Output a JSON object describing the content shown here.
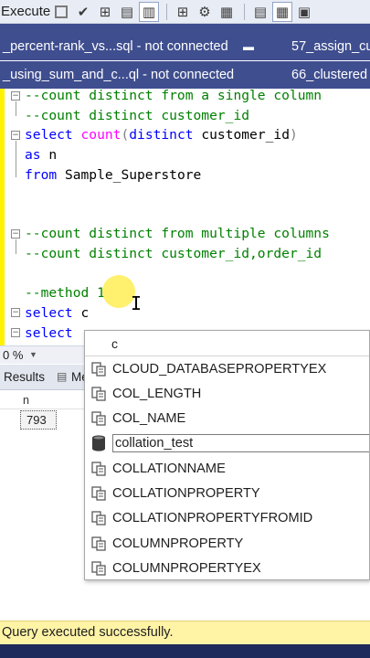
{
  "toolbar": {
    "execute_label": "Execute",
    "icons": [
      "stop-icon",
      "parse-checkmark-icon",
      "display-estimated-plan-icon",
      "query-options-icon",
      "results-to-text-icon",
      "display-plan-icon",
      "include-statistics-icon",
      "results-to-file-icon",
      "results-to-grid-icon",
      "results-to-text-alt-icon"
    ]
  },
  "tabs": {
    "row1": {
      "left": "_percent-rank_vs...sql - not connected",
      "pin": "▬",
      "right": "57_assign_cu"
    },
    "row2": {
      "left": "_using_sum_and_c...ql - not connected",
      "right": "66_clustered"
    }
  },
  "editor": {
    "lines": [
      "--count distinct from a single column",
      "--count distinct customer_id",
      "select count(distinct customer_id)",
      "as n",
      "from Sample_Superstore",
      "--count distinct from multiple columns",
      "--count distinct customer_id,order_id",
      "--method 1",
      "select c",
      "select"
    ],
    "tokens": {
      "select": "select",
      "count": "count",
      "lparen": "(",
      "distinct": "distinct",
      "customer_id": " customer_id",
      "rparen": ")",
      "as": "as",
      "n": " n",
      "from": "from",
      "table": " Sample_Superstore",
      "c": " c"
    }
  },
  "zoom": {
    "value": "0 %"
  },
  "results": {
    "results_tab": "Results",
    "messages_tab": "Me",
    "column_header": "n",
    "cell_value": "793"
  },
  "autocomplete": {
    "filter": "c",
    "items": [
      {
        "label": "CLOUD_DATABASEPROPERTYEX",
        "icon": "function-icon"
      },
      {
        "label": "COL_LENGTH",
        "icon": "function-icon"
      },
      {
        "label": "COL_NAME",
        "icon": "function-icon"
      },
      {
        "label": "collation_test",
        "icon": "database-icon",
        "selected": true
      },
      {
        "label": "COLLATIONNAME",
        "icon": "function-icon"
      },
      {
        "label": "COLLATIONPROPERTY",
        "icon": "function-icon"
      },
      {
        "label": "COLLATIONPROPERTYFROMID",
        "icon": "function-icon"
      },
      {
        "label": "COLUMNPROPERTY",
        "icon": "function-icon"
      },
      {
        "label": "COLUMNPROPERTYEX",
        "icon": "function-icon"
      }
    ]
  },
  "status": {
    "message": "Query executed successfully."
  },
  "colors": {
    "tab_background": "#3f4e8f",
    "comment": "#008000",
    "keyword": "#0000ff",
    "function": "#ff00ff",
    "status_background": "#fff3a6"
  }
}
